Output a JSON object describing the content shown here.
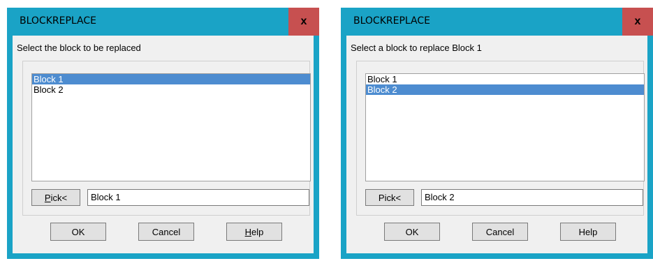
{
  "dialogs": [
    {
      "title": "BLOCKREPLACE",
      "close_label": "x",
      "prompt": "Select the block to be replaced",
      "list_items": [
        "Block 1",
        "Block 2"
      ],
      "selected_index": 0,
      "pick_label_mnemonic": "P",
      "pick_label_rest": "ick<",
      "name_value": "Block 1",
      "ok_label": "OK",
      "cancel_label": "Cancel",
      "help_label_mnemonic": "H",
      "help_label_rest": "elp"
    },
    {
      "title": "BLOCKREPLACE",
      "close_label": "x",
      "prompt": "Select a block to replace Block 1",
      "list_items": [
        "Block 1",
        "Block 2"
      ],
      "selected_index": 1,
      "pick_label": "Pick<",
      "name_value": "Block 2",
      "ok_label": "OK",
      "cancel_label": "Cancel",
      "help_label": "Help"
    }
  ],
  "colors": {
    "frame": "#1aa3c6",
    "close_button": "#c75050",
    "selection": "#4d8cd0",
    "client_bg": "#f0f0f0"
  }
}
